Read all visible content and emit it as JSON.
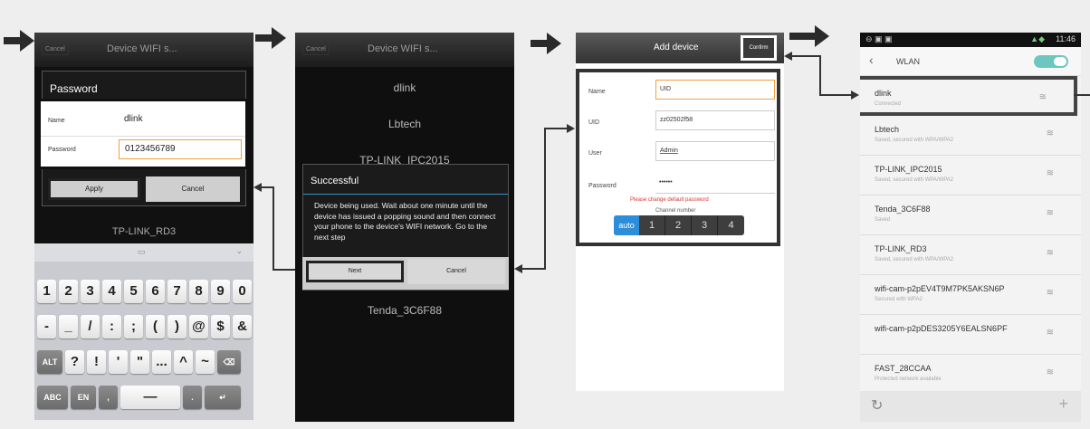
{
  "p1": {
    "cancel": "Cancel",
    "title": "Device WIFI s...",
    "dlg_title": "Password",
    "name_label": "Name",
    "name_value": "dlink",
    "pw_label": "Password",
    "pw_value": "0123456789",
    "apply": "Apply",
    "cancel_btn": "Cancel",
    "bottom_net": "TP-LINK_RD3",
    "kb_row1": [
      "1",
      "2",
      "3",
      "4",
      "5",
      "6",
      "7",
      "8",
      "9",
      "0"
    ],
    "kb_row2": [
      "-",
      "_",
      "/",
      ":",
      ";",
      "(",
      ")",
      "@",
      "$",
      "&"
    ],
    "kb_row3": [
      "ALT",
      "?",
      "!",
      "'",
      "\"",
      "...",
      "^",
      "~",
      "⌫"
    ],
    "kb_row4": [
      "ABC",
      "EN",
      ",",
      "—",
      ".",
      "↵"
    ]
  },
  "p2": {
    "cancel": "Cancel",
    "title": "Device WIFI s...",
    "nets": [
      "dlink",
      "Lbtech",
      "TP-LINK_IPC2015",
      "Tenda_3C6F88"
    ],
    "dlg_title": "Successful",
    "dlg_text": "Device being used. Wait about one minute until the device has issued a popping sound and then connect your phone to the device's WIFI network. Go to the next step",
    "next": "Next",
    "cancel_btn": "Cancel"
  },
  "p3": {
    "title": "Add device",
    "confirm": "Confirm",
    "name_l": "Name",
    "name_v": "UID",
    "uid_l": "UID",
    "uid_v": "zz02502f58",
    "user_l": "User",
    "user_v": "Admin",
    "pw_l": "Password",
    "pw_v": "••••••",
    "warn": "Please change default password",
    "channel": "Channel number",
    "channels": [
      "auto",
      "1",
      "2",
      "3",
      "4"
    ]
  },
  "p4": {
    "status_time": "11:46",
    "header": "WLAN",
    "nets": [
      {
        "n": "dlink",
        "s": "Connected"
      },
      {
        "n": "Lbtech",
        "s": "Saved, secured with WPA/WPA2"
      },
      {
        "n": "TP-LINK_IPC2015",
        "s": "Saved, secured with WPA/WPA2"
      },
      {
        "n": "Tenda_3C6F88",
        "s": "Saved"
      },
      {
        "n": "TP-LINK_RD3",
        "s": "Saved, secured with WPA/WPA2"
      },
      {
        "n": "wifi-cam-p2pEV4T9M7PK5AKSN6P",
        "s": "Secured with WPA2"
      },
      {
        "n": "wifi-cam-p2pDES3205Y6EALSN6PF",
        "s": ""
      },
      {
        "n": "FAST_28CCAA",
        "s": "Protected network available"
      }
    ]
  }
}
